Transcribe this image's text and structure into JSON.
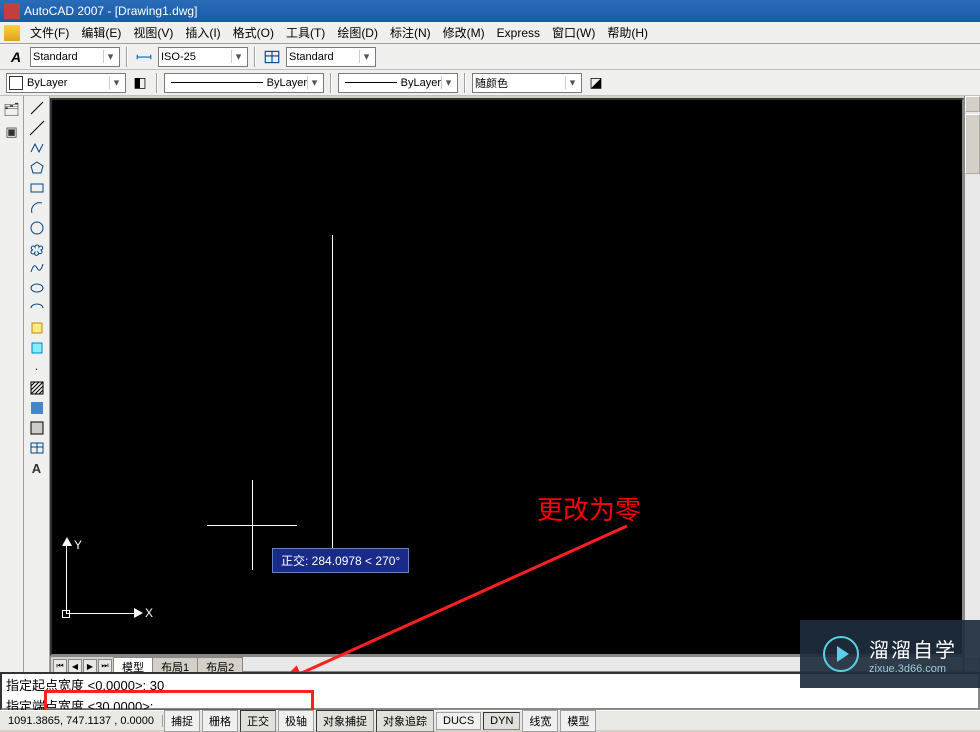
{
  "titlebar": {
    "title": "AutoCAD 2007 - [Drawing1.dwg]"
  },
  "menu": {
    "file": "文件(F)",
    "edit": "编辑(E)",
    "view": "视图(V)",
    "insert": "插入(I)",
    "format": "格式(O)",
    "tools": "工具(T)",
    "draw": "绘图(D)",
    "dimension": "标注(N)",
    "modify": "修改(M)",
    "express": "Express",
    "window": "窗口(W)",
    "help": "帮助(H)"
  },
  "toolbar1": {
    "style": "Standard",
    "dim_style": "ISO-25",
    "table_style": "Standard"
  },
  "toolbar2": {
    "layer": "ByLayer",
    "linetype": "ByLayer",
    "lineweight": "ByLayer",
    "color": "随颜色"
  },
  "ucs": {
    "x": "X",
    "y": "Y"
  },
  "tooltip": {
    "text": "正交: 284.0978 < 270°"
  },
  "annotation": {
    "text": "更改为零"
  },
  "tabs": {
    "model": "模型",
    "layout1": "布局1",
    "layout2": "布局2"
  },
  "command": {
    "history": "指定起点宽度 <0.0000>: 30",
    "prompt": "指定端点宽度 <30.0000>:"
  },
  "status": {
    "coords": "1091.3865, 747.1137 , 0.0000",
    "snap": "捕捉",
    "grid": "栅格",
    "ortho": "正交",
    "polar": "极轴",
    "osnap": "对象捕捉",
    "otrack": "对象追踪",
    "ducs": "DUCS",
    "dyn": "DYN",
    "lwt": "线宽",
    "model": "模型"
  },
  "watermark": {
    "big": "溜溜自学",
    "small": "zixue.3d66.com"
  }
}
